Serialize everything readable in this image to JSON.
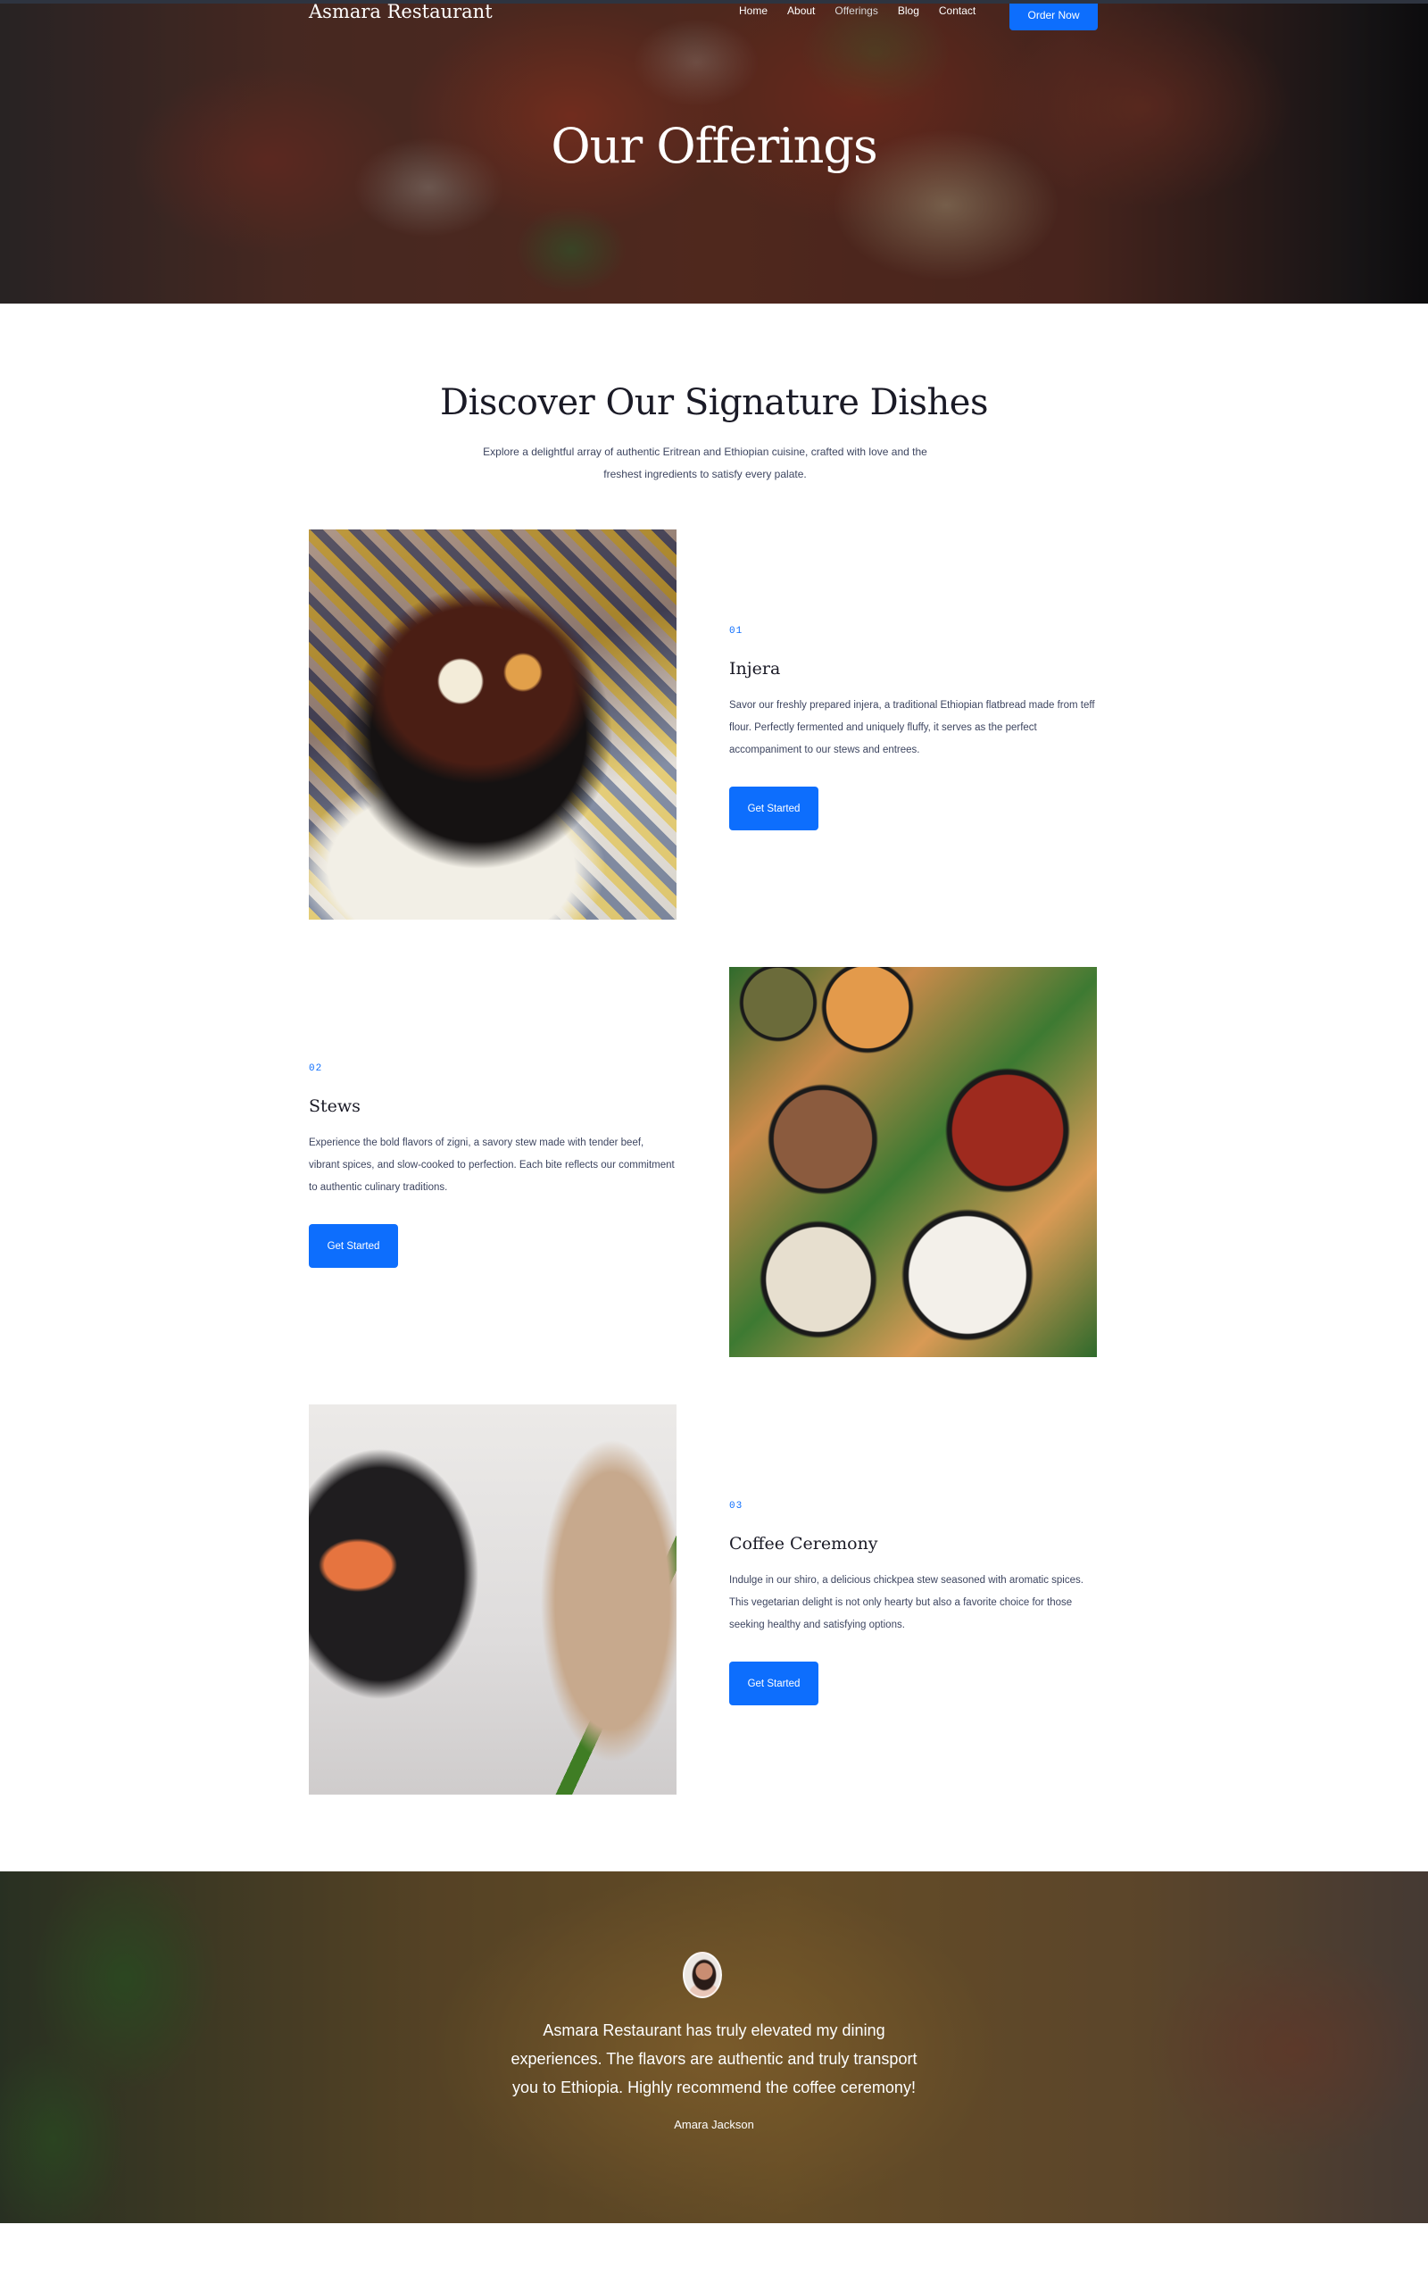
{
  "header": {
    "brand": "Asmara Restaurant",
    "nav": [
      "Home",
      "About",
      "Offerings",
      "Blog",
      "Contact"
    ],
    "cta_label": "Order Now"
  },
  "hero": {
    "title": "Our Offerings"
  },
  "intro": {
    "title": "Discover Our Signature Dishes",
    "subtitle": "Explore a delightful array of authentic Eritrean and Ethiopian cuisine, crafted with love and the freshest ingredients to satisfy every palate."
  },
  "dishes": [
    {
      "number": "01",
      "name": "Injera",
      "description": "Savor our freshly prepared injera, a traditional Ethiopian flatbread made from teff flour. Perfectly fermented and uniquely fluffy, it serves as the perfect accompaniment to our stews and entrees.",
      "button_label": "Get Started"
    },
    {
      "number": "02",
      "name": "Stews",
      "description": "Experience the bold flavors of zigni, a savory stew made with tender beef, vibrant spices, and slow-cooked to perfection. Each bite reflects our commitment to authentic culinary traditions.",
      "button_label": "Get Started"
    },
    {
      "number": "03",
      "name": "Coffee Ceremony",
      "description": "Indulge in our shiro, a delicious chickpea stew seasoned with aromatic spices. This vegetarian delight is not only hearty but also a favorite choice for those seeking healthy and satisfying options.",
      "button_label": "Get Started"
    }
  ],
  "testimonial": {
    "quote": "Asmara Restaurant has truly elevated my dining experiences. The flavors are authentic and truly transport you to Ethiopia. Highly recommend the coffee ceremony!",
    "author": "Amara Jackson"
  },
  "colors": {
    "accent": "#0d6efd",
    "heading": "#1a1a26",
    "body_text": "#3d4560"
  }
}
